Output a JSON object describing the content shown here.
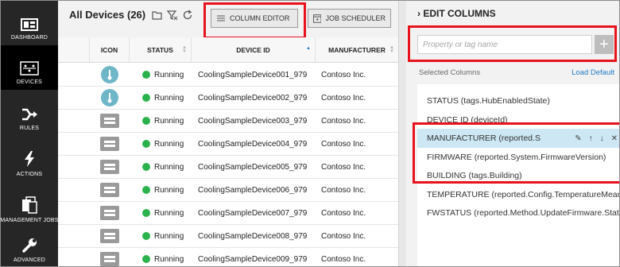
{
  "nav": {
    "items": [
      {
        "label": "DASHBOARD",
        "icon": "dashboard-icon",
        "active": false
      },
      {
        "label": "DEVICES",
        "icon": "devices-icon",
        "active": true
      },
      {
        "label": "RULES",
        "icon": "rules-icon",
        "active": false
      },
      {
        "label": "ACTIONS",
        "icon": "actions-icon",
        "active": false
      },
      {
        "label": "MANAGEMENT JOBS",
        "icon": "management-jobs-icon",
        "active": false
      },
      {
        "label": "ADVANCED",
        "icon": "advanced-icon",
        "active": false
      }
    ]
  },
  "devices": {
    "title": "All Devices (26)",
    "column_editor_label": "COLUMN EDITOR",
    "job_scheduler_label": "JOB SCHEDULER",
    "columns": [
      "ICON",
      "STATUS",
      "DEVICE ID",
      "MANUFACTURER"
    ],
    "rows": [
      {
        "icon": "thermometer-icon",
        "status": "Running",
        "device_id": "CoolingSampleDevice001_979",
        "manufacturer": "Contoso Inc."
      },
      {
        "icon": "thermometer-icon",
        "status": "Running",
        "device_id": "CoolingSampleDevice002_979",
        "manufacturer": "Contoso Inc."
      },
      {
        "icon": "device-icon",
        "status": "Running",
        "device_id": "CoolingSampleDevice003_979",
        "manufacturer": "Contoso Inc."
      },
      {
        "icon": "device-icon",
        "status": "Running",
        "device_id": "CoolingSampleDevice004_979",
        "manufacturer": "Contoso Inc."
      },
      {
        "icon": "device-icon",
        "status": "Running",
        "device_id": "CoolingSampleDevice005_979",
        "manufacturer": "Contoso Inc."
      },
      {
        "icon": "device-icon",
        "status": "Running",
        "device_id": "CoolingSampleDevice006_979",
        "manufacturer": "Contoso Inc."
      },
      {
        "icon": "device-icon",
        "status": "Running",
        "device_id": "CoolingSampleDevice007_979",
        "manufacturer": "Contoso Inc."
      },
      {
        "icon": "device-icon",
        "status": "Running",
        "device_id": "CoolingSampleDevice008_979",
        "manufacturer": "Contoso Inc."
      },
      {
        "icon": "device-icon",
        "status": "Running",
        "device_id": "CoolingSampleDevice009_979",
        "manufacturer": "Contoso Inc."
      }
    ]
  },
  "edit_columns": {
    "title": "EDIT COLUMNS",
    "input_placeholder": "Property or tag name",
    "add_label": "+",
    "selected_columns_label": "Selected Columns",
    "load_default_label": "Load Default",
    "columns": [
      {
        "label": "STATUS (tags.HubEnabledState)",
        "selected": false
      },
      {
        "label": "DEVICE ID (deviceId)",
        "selected": false
      },
      {
        "label": "MANUFACTURER (reported.S",
        "selected": true
      },
      {
        "label": "FIRMWARE (reported.System.FirmwareVersion)",
        "selected": false
      },
      {
        "label": "BUILDING (tags.Building)",
        "selected": false
      },
      {
        "label": "TEMPERATURE (reported.Config.TemperatureMeanValue)",
        "selected": false
      },
      {
        "label": "FWSTATUS (reported.Method.UpdateFirmware.Status)",
        "selected": false
      }
    ]
  },
  "colors": {
    "nav_bg": "#262626",
    "highlight": "#e8121c",
    "running": "#2bb24c",
    "link": "#1f7bc4",
    "selected_row": "#cde7f5"
  }
}
